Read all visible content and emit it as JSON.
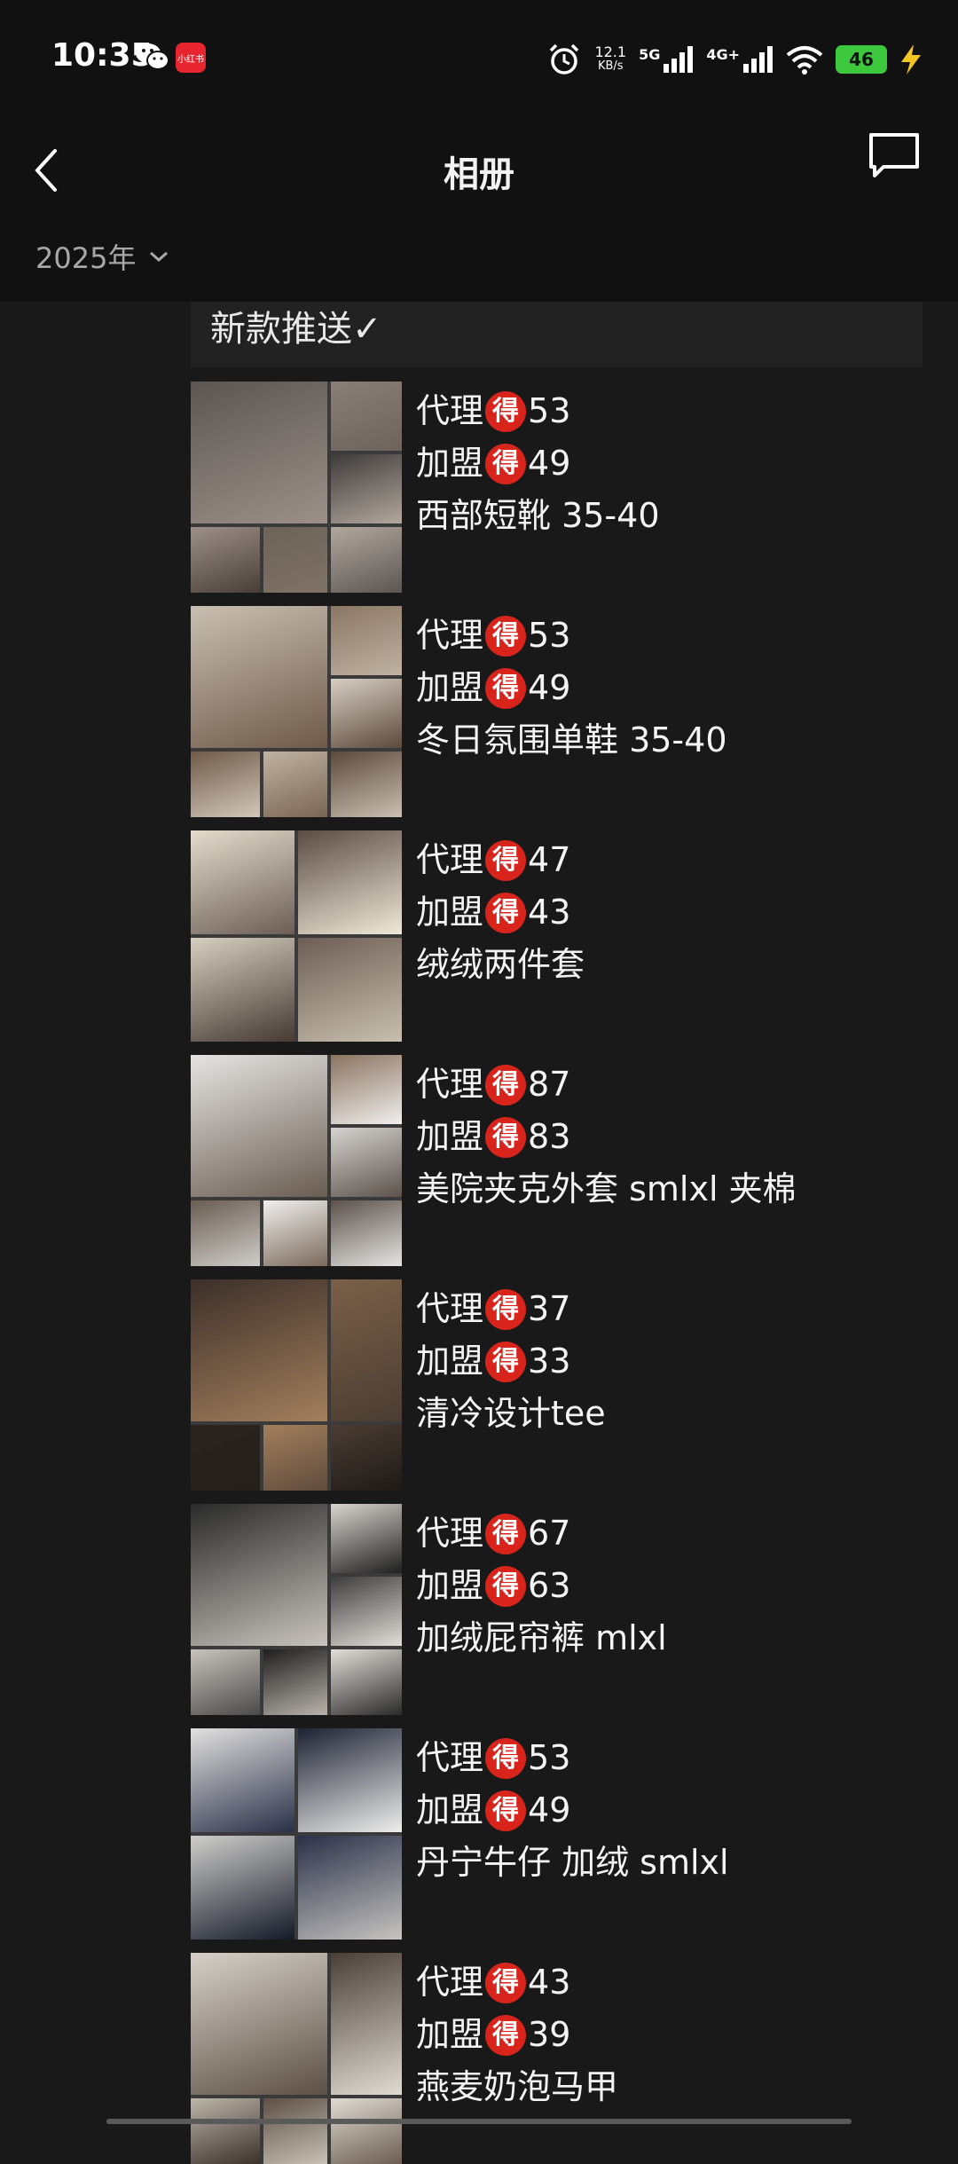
{
  "status_bar": {
    "time": "10:35",
    "xhs_label": "小红书",
    "speed_value": "12.1",
    "speed_unit": "KB/s",
    "net1": "5G",
    "net2": "4G+",
    "battery": "46"
  },
  "header": {
    "title": "相册",
    "year_filter": "2025年"
  },
  "banner": "新款推送✓",
  "de_char": "得",
  "items": [
    {
      "agent_label": "代理",
      "agent_price": "53",
      "franchise_label": "加盟",
      "franchise_price": "49",
      "desc": "西部短靴 35-40"
    },
    {
      "agent_label": "代理",
      "agent_price": "53",
      "franchise_label": "加盟",
      "franchise_price": "49",
      "desc": "冬日氛围单鞋 35-40"
    },
    {
      "agent_label": "代理",
      "agent_price": "47",
      "franchise_label": "加盟",
      "franchise_price": "43",
      "desc": "绒绒两件套"
    },
    {
      "agent_label": "代理",
      "agent_price": "87",
      "franchise_label": "加盟",
      "franchise_price": "83",
      "desc": "美院夹克外套  smlxl  夹棉"
    },
    {
      "agent_label": "代理",
      "agent_price": "37",
      "franchise_label": "加盟",
      "franchise_price": "33",
      "desc": "清冷设计tee"
    },
    {
      "agent_label": "代理",
      "agent_price": "67",
      "franchise_label": "加盟",
      "franchise_price": "63",
      "desc": "加绒屁帘裤  mlxl"
    },
    {
      "agent_label": "代理",
      "agent_price": "53",
      "franchise_label": "加盟",
      "franchise_price": "49",
      "desc": "丹宁牛仔 加绒 smlxl"
    },
    {
      "agent_label": "代理",
      "agent_price": "43",
      "franchise_label": "加盟",
      "franchise_price": "39",
      "desc": "燕麦奶泡马甲"
    }
  ],
  "colors": {
    "background": "#191919",
    "header": "#111111",
    "de_badge": "#d9241c",
    "battery": "#3ec83e"
  }
}
